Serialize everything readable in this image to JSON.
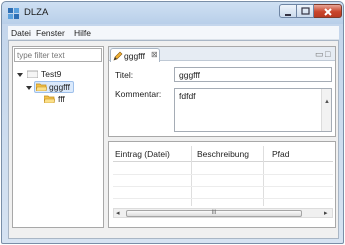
{
  "window": {
    "title": "DLZA"
  },
  "menu": [
    "Datei",
    "Fenster",
    "Hilfe"
  ],
  "left_panel": {
    "filter_placeholder": "type filter text",
    "tree": [
      {
        "label": "Test9",
        "level": 0,
        "expanded": true,
        "icon": "folder-closed-icon"
      },
      {
        "label": "gggfff",
        "level": 1,
        "expanded": true,
        "selected": true,
        "icon": "folder-open-icon"
      },
      {
        "label": "fff",
        "level": 2,
        "icon": "folder-open-icon"
      }
    ]
  },
  "editor": {
    "tab_label": "gggfff",
    "title_label": "Titel:",
    "title_value": "gggfff",
    "comment_label": "Kommentar:",
    "comment_value": "fdfdf"
  },
  "table": {
    "columns": [
      "Eintrag (Datei)",
      "Beschreibung",
      "Pfad"
    ],
    "scroll_thumb_label": "III"
  },
  "colors": {
    "folder": "#f2c24a",
    "selection": "#dbeafc",
    "close_button": "#c9452c"
  }
}
